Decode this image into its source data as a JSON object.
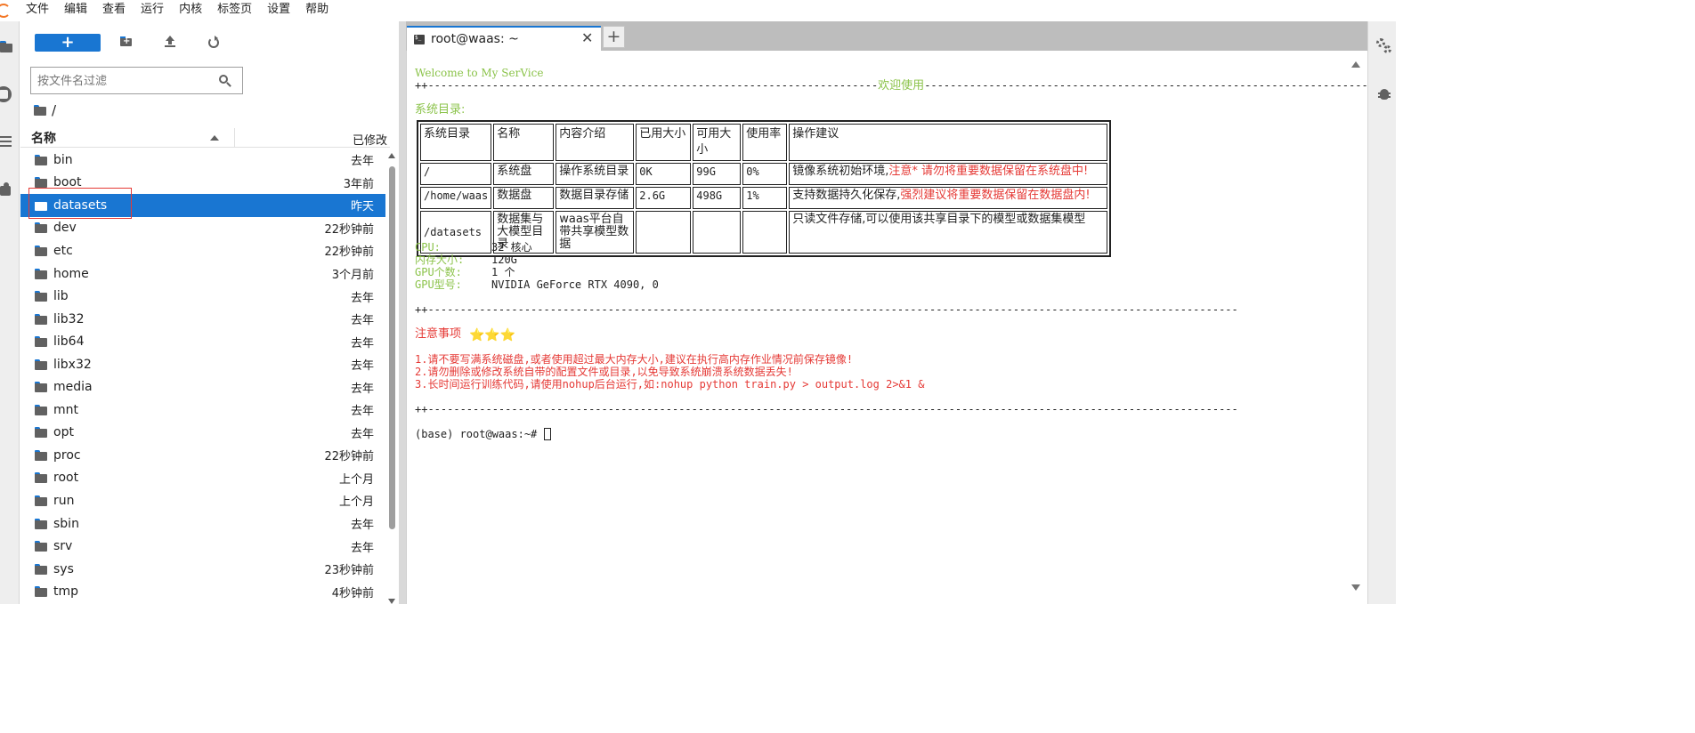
{
  "menu": [
    "文件",
    "编辑",
    "查看",
    "运行",
    "内核",
    "标签页",
    "设置",
    "帮助"
  ],
  "filebrowser": {
    "new_button": "+",
    "filter_placeholder": "按文件名过滤",
    "breadcrumb": "/",
    "header_name": "名称",
    "header_modified": "已修改",
    "files": [
      {
        "name": "bin",
        "modified": "去年"
      },
      {
        "name": "boot",
        "modified": "3年前"
      },
      {
        "name": "datasets",
        "modified": "昨天"
      },
      {
        "name": "dev",
        "modified": "22秒钟前"
      },
      {
        "name": "etc",
        "modified": "22秒钟前"
      },
      {
        "name": "home",
        "modified": "3个月前"
      },
      {
        "name": "lib",
        "modified": "去年"
      },
      {
        "name": "lib32",
        "modified": "去年"
      },
      {
        "name": "lib64",
        "modified": "去年"
      },
      {
        "name": "libx32",
        "modified": "去年"
      },
      {
        "name": "media",
        "modified": "去年"
      },
      {
        "name": "mnt",
        "modified": "去年"
      },
      {
        "name": "opt",
        "modified": "去年"
      },
      {
        "name": "proc",
        "modified": "22秒钟前"
      },
      {
        "name": "root",
        "modified": "上个月"
      },
      {
        "name": "run",
        "modified": "上个月"
      },
      {
        "name": "sbin",
        "modified": "去年"
      },
      {
        "name": "srv",
        "modified": "去年"
      },
      {
        "name": "sys",
        "modified": "23秒钟前"
      },
      {
        "name": "tmp",
        "modified": "4秒钟前"
      }
    ]
  },
  "terminal_tab": {
    "label": "root@waas: ~",
    "close": "✕",
    "add": "+"
  },
  "terminal": {
    "welcome": "Welcome to My SerVice",
    "rule_top_left": "++----------------------------------------------------------------------",
    "rule_top_title": "欢迎使用",
    "rule_top_right": "-----------------------------------------------------------------------++",
    "section_title": "系统目录:",
    "table_headers": [
      "系统目录",
      "名称",
      "内容介绍",
      "已用大小",
      "可用大小",
      "使用率",
      "操作建议"
    ],
    "rows": [
      {
        "dir": "/",
        "name": "系统盘",
        "desc": "操作系统目录",
        "used": "0K",
        "avail": "99G",
        "usage": "0%",
        "advice": "镜像系统初始环境,",
        "warning": "注意* 请勿将重要数据保留在系统盘中!"
      },
      {
        "dir": "/home/waas",
        "name": "数据盘",
        "desc": "数据目录存储",
        "used": "2.6G",
        "avail": "498G",
        "usage": "1%",
        "advice": "支持数据持久化保存,",
        "warning": "强烈建议将重要数据保留在数据盘内!"
      },
      {
        "dir": "/datasets",
        "name": "数据集与大模型目录",
        "desc": "waas平台自带共享模型数据",
        "used": "",
        "avail": "",
        "usage": "",
        "advice": "只读文件存储,可以使用该共享目录下的模型或数据集模型",
        "warning": ""
      }
    ],
    "sysinfo": [
      {
        "label": "CPU:",
        "value": "32 核心"
      },
      {
        "label": "内存大小:",
        "value": "120G"
      },
      {
        "label": "GPU个数:",
        "value": "1 个"
      },
      {
        "label": "GPU型号:",
        "value": "NVIDIA GeForce RTX 4090, 0"
      }
    ],
    "rule": "++-------------------------------------------------------------------------------------------------------------------------------------------------------++",
    "notice_title": "注意事项",
    "notice_stars": "⭐⭐⭐",
    "notices": [
      "1.请不要写满系统磁盘,或者使用超过最大内存大小,建议在执行高内存作业情况前保存镜像!",
      "2.请勿删除或修改系统自带的配置文件或目录,以免导致系统崩溃系统数据丢失!",
      "3.长时间运行训练代码,请使用nohup后台运行,如:nohup python train.py > output.log 2>&1 &"
    ],
    "prompt": "(base) root@waas:~# "
  },
  "colors": {
    "accent": "#1976d2",
    "green": "#8bc34a",
    "red": "#e53935"
  }
}
